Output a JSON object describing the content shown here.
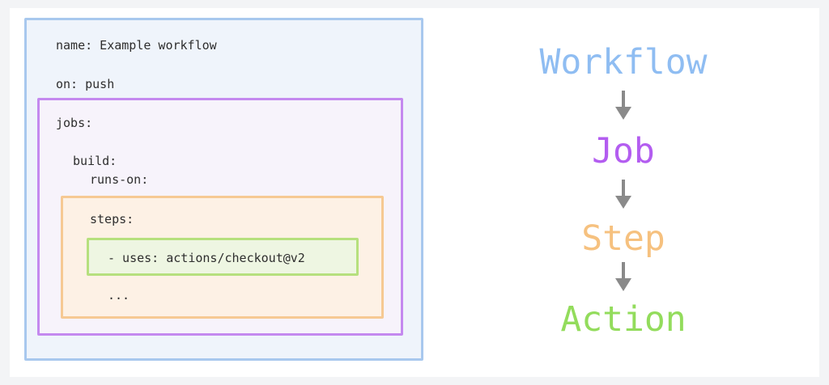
{
  "yaml": {
    "name_line": "name: Example workflow",
    "on_line": "on: push",
    "jobs_line": "jobs:",
    "build_line": "build:",
    "runs_on_line": "runs-on:",
    "steps_line": "steps:",
    "uses_line": "- uses: actions/checkout@v2",
    "ellipsis_line": "..."
  },
  "hierarchy": {
    "levels": [
      {
        "label": "Workflow",
        "color": "#8fbdf2"
      },
      {
        "label": "Job",
        "color": "#b35df0"
      },
      {
        "label": "Step",
        "color": "#f6c17f"
      },
      {
        "label": "Action",
        "color": "#93dc5c"
      }
    ],
    "arrow_color": "#8a8a8a"
  }
}
